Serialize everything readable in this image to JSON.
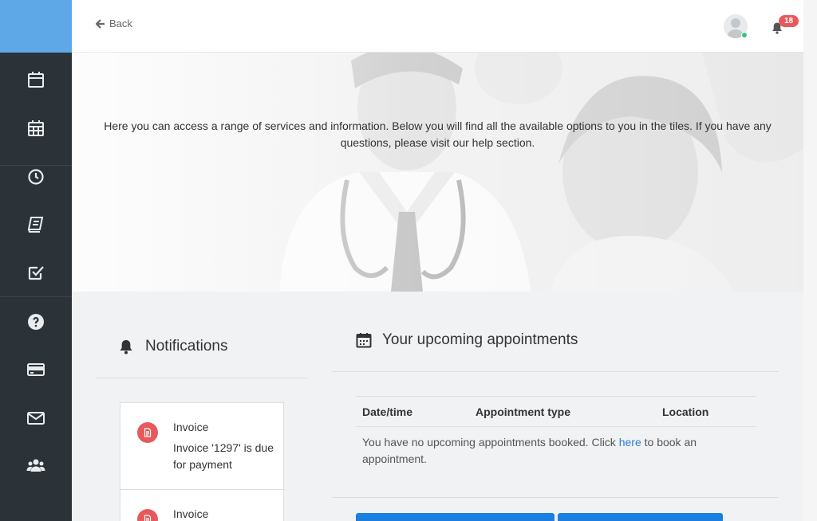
{
  "header": {
    "back_label": "Back",
    "notification_count": "18"
  },
  "hero": {
    "intro": "Here you can access a range of services and information. Below you will find all the available options to you in the tiles. If you have any questions, please visit our help section."
  },
  "sidebar": {
    "items": [
      {
        "icon": "calendar-icon"
      },
      {
        "icon": "calendar-grid-icon"
      },
      {
        "icon": "clock-icon"
      },
      {
        "icon": "book-icon"
      },
      {
        "icon": "checkbox-icon"
      },
      {
        "icon": "question-icon"
      },
      {
        "icon": "credit-card-icon"
      },
      {
        "icon": "envelope-icon"
      },
      {
        "icon": "users-icon"
      }
    ]
  },
  "notifications": {
    "title": "Notifications",
    "items": [
      {
        "title": "Invoice",
        "body": "Invoice '1297' is due for payment",
        "icon": "invoice-icon"
      },
      {
        "title": "Invoice",
        "body": "",
        "icon": "invoice-icon"
      }
    ]
  },
  "appointments": {
    "title": "Your upcoming appointments",
    "columns": [
      "Date/time",
      "Appointment type",
      "Location"
    ],
    "empty_prefix": "You have no upcoming appointments booked. Click ",
    "empty_link": "here",
    "empty_suffix": " to book an appointment."
  },
  "colors": {
    "sidebar_bg": "#2c3338",
    "brand": "#5fa8e8",
    "accent": "#1a7fe3",
    "badge": "#e8595b",
    "link": "#2a7fd4"
  }
}
